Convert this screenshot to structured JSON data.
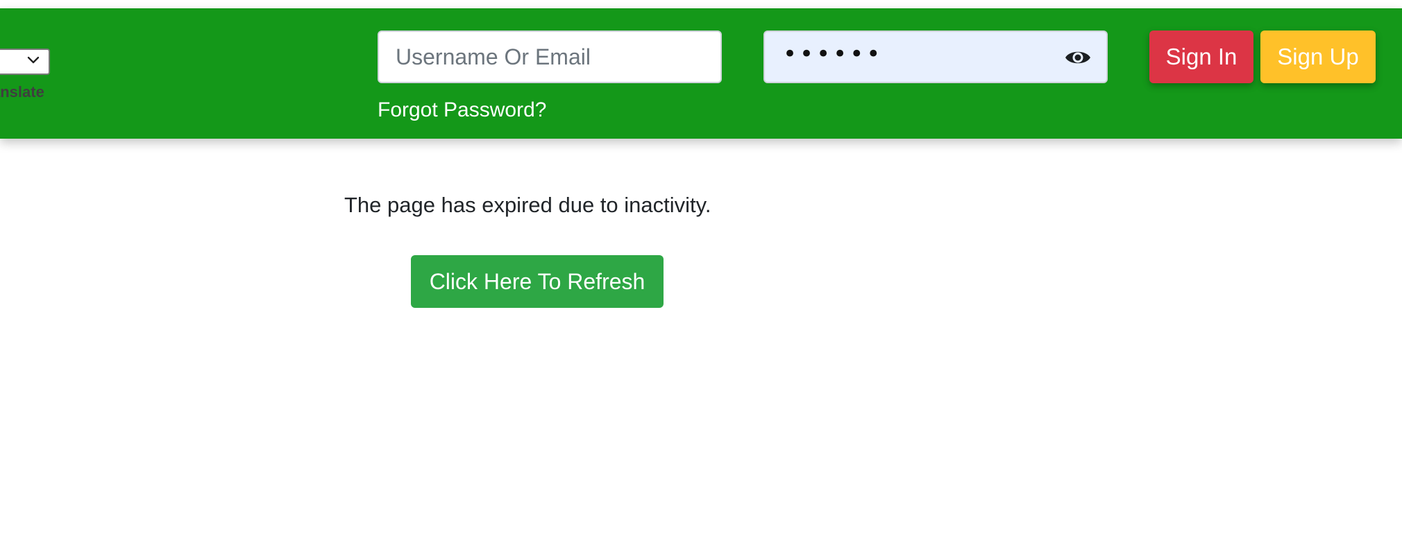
{
  "language": {
    "translate_label": "anslate",
    "selected_value": ""
  },
  "login": {
    "username_placeholder": "Username Or Email",
    "password_mask": "••••••",
    "forgot_password": "Forgot Password?",
    "sign_in": "Sign In",
    "sign_up": "Sign Up"
  },
  "main": {
    "message": "The page has expired due to inactivity.",
    "refresh_button": "Click Here To Refresh"
  },
  "colors": {
    "header_bg": "#149819",
    "sign_in_bg": "#dc3545",
    "sign_up_bg": "#ffc129",
    "refresh_bg": "#2ea745"
  },
  "icons": {
    "password_toggle": "eye-icon",
    "select_arrow": "chevron-down-icon"
  }
}
